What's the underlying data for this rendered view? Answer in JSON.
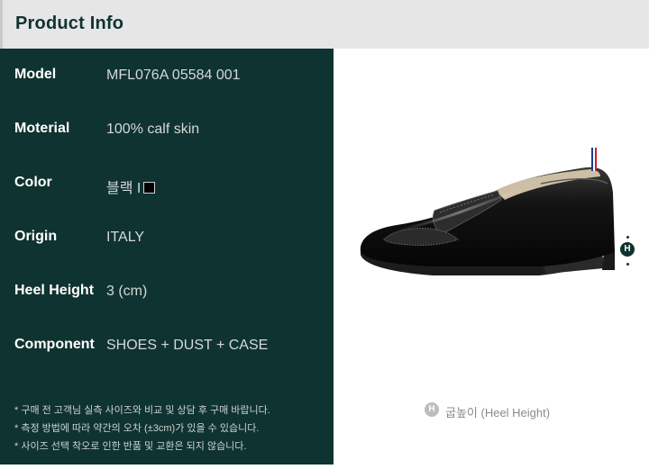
{
  "header": {
    "title": "Product Info"
  },
  "specs": [
    {
      "label": "Model",
      "value": "MFL076A 05584 001"
    },
    {
      "label": "Moterial",
      "value": "100% calf skin"
    },
    {
      "label": "Color",
      "value": "블랙 I"
    },
    {
      "label": "Origin",
      "value": "ITALY"
    },
    {
      "label": "Heel Height",
      "value": "3 (cm)"
    },
    {
      "label": "Component",
      "value": "SHOES + DUST + CASE"
    }
  ],
  "color_swatch": "#000000",
  "notes": [
    "* 구매 전 고객님 실측 사이즈와 비교 및 상담 후 구매 바랍니다.",
    "* 측정 방법에 따라 약간의 오차 (±3cm)가 있을 수 있습니다.",
    "* 사이즈 선택 착오로 인한 반품 및 교환은 되지 않습니다."
  ],
  "heel_marker": {
    "letter": "H"
  },
  "caption": {
    "icon_letter": "H",
    "text": "굽높이 (Heel Height)"
  },
  "product_image": {
    "icon": "loafer-shoe-image"
  }
}
